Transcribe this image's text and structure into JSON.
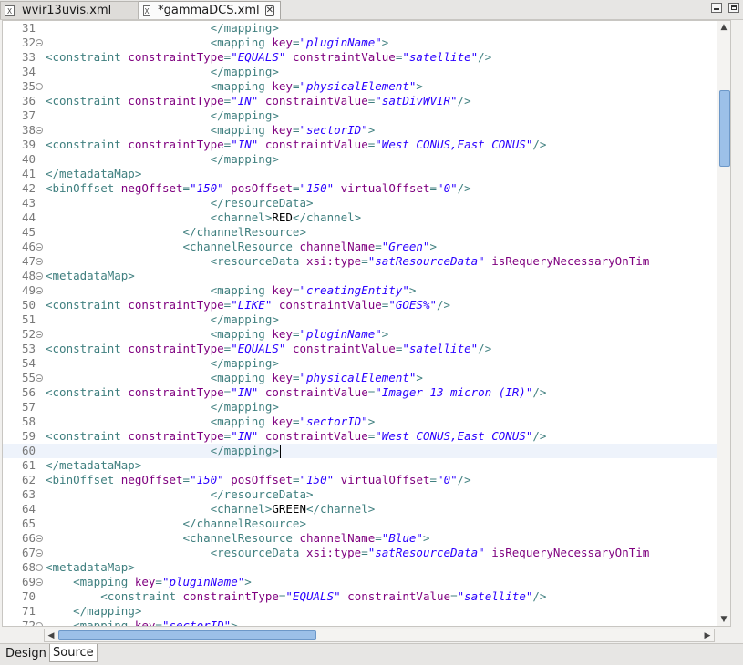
{
  "tabs": [
    {
      "label": "wvir13uvis.xml",
      "icon": "xml-file-icon",
      "active": false
    },
    {
      "label": "*gammaDCS.xml",
      "icon": "xml-file-icon",
      "active": true
    }
  ],
  "bottom_tabs": [
    {
      "label": "Design",
      "active": false
    },
    {
      "label": "Source",
      "active": true
    }
  ],
  "colors": {
    "tag": "#3f7f7f",
    "attr_name": "#7f007f",
    "attr_value": "#2a00ff",
    "text": "#000000",
    "line_number": "#787878"
  },
  "cursor_line": 60,
  "lines": [
    {
      "n": "31",
      "fold": false,
      "tokens": [
        [
          "s",
          "                        "
        ],
        [
          "t",
          "</mapping>"
        ]
      ]
    },
    {
      "n": "32",
      "fold": true,
      "tokens": [
        [
          "s",
          "                        "
        ],
        [
          "t",
          "<mapping "
        ],
        [
          "a",
          "key"
        ],
        [
          "t",
          "="
        ],
        [
          "v",
          "\"pluginName\""
        ],
        [
          "t",
          ">"
        ]
      ]
    },
    {
      "n": "33",
      "fold": false,
      "tokens": [
        [
          "t",
          "<constraint "
        ],
        [
          "a",
          "constraintType"
        ],
        [
          "t",
          "="
        ],
        [
          "v",
          "\"EQUALS\""
        ],
        [
          "s",
          " "
        ],
        [
          "a",
          "constraintValue"
        ],
        [
          "t",
          "="
        ],
        [
          "v",
          "\"satellite\""
        ],
        [
          "t",
          "/>"
        ]
      ]
    },
    {
      "n": "34",
      "fold": false,
      "tokens": [
        [
          "s",
          "                        "
        ],
        [
          "t",
          "</mapping>"
        ]
      ]
    },
    {
      "n": "35",
      "fold": true,
      "tokens": [
        [
          "s",
          "                        "
        ],
        [
          "t",
          "<mapping "
        ],
        [
          "a",
          "key"
        ],
        [
          "t",
          "="
        ],
        [
          "v",
          "\"physicalElement\""
        ],
        [
          "t",
          ">"
        ]
      ]
    },
    {
      "n": "36",
      "fold": false,
      "tokens": [
        [
          "t",
          "<constraint "
        ],
        [
          "a",
          "constraintType"
        ],
        [
          "t",
          "="
        ],
        [
          "v",
          "\"IN\""
        ],
        [
          "s",
          " "
        ],
        [
          "a",
          "constraintValue"
        ],
        [
          "t",
          "="
        ],
        [
          "v",
          "\"satDivWVIR\""
        ],
        [
          "t",
          "/>"
        ]
      ]
    },
    {
      "n": "37",
      "fold": false,
      "tokens": [
        [
          "s",
          "                        "
        ],
        [
          "t",
          "</mapping>"
        ]
      ]
    },
    {
      "n": "38",
      "fold": true,
      "tokens": [
        [
          "s",
          "                        "
        ],
        [
          "t",
          "<mapping "
        ],
        [
          "a",
          "key"
        ],
        [
          "t",
          "="
        ],
        [
          "v",
          "\"sectorID\""
        ],
        [
          "t",
          ">"
        ]
      ]
    },
    {
      "n": "39",
      "fold": false,
      "tokens": [
        [
          "t",
          "<constraint "
        ],
        [
          "a",
          "constraintType"
        ],
        [
          "t",
          "="
        ],
        [
          "v",
          "\"IN\""
        ],
        [
          "s",
          " "
        ],
        [
          "a",
          "constraintValue"
        ],
        [
          "t",
          "="
        ],
        [
          "v",
          "\"West CONUS,East CONUS\""
        ],
        [
          "t",
          "/>"
        ]
      ]
    },
    {
      "n": "40",
      "fold": false,
      "tokens": [
        [
          "s",
          "                        "
        ],
        [
          "t",
          "</mapping>"
        ]
      ]
    },
    {
      "n": "41",
      "fold": false,
      "tokens": [
        [
          "t",
          "</metadataMap>"
        ]
      ]
    },
    {
      "n": "42",
      "fold": false,
      "tokens": [
        [
          "t",
          "<binOffset "
        ],
        [
          "a",
          "negOffset"
        ],
        [
          "t",
          "="
        ],
        [
          "v",
          "\"150\""
        ],
        [
          "s",
          " "
        ],
        [
          "a",
          "posOffset"
        ],
        [
          "t",
          "="
        ],
        [
          "v",
          "\"150\""
        ],
        [
          "s",
          " "
        ],
        [
          "a",
          "virtualOffset"
        ],
        [
          "t",
          "="
        ],
        [
          "v",
          "\"0\""
        ],
        [
          "t",
          "/>"
        ]
      ]
    },
    {
      "n": "43",
      "fold": false,
      "tokens": [
        [
          "s",
          "                        "
        ],
        [
          "t",
          "</resourceData>"
        ]
      ]
    },
    {
      "n": "44",
      "fold": false,
      "tokens": [
        [
          "s",
          "                        "
        ],
        [
          "t",
          "<channel>"
        ],
        [
          "x",
          "RED"
        ],
        [
          "t",
          "</channel>"
        ]
      ]
    },
    {
      "n": "45",
      "fold": false,
      "tokens": [
        [
          "s",
          "                    "
        ],
        [
          "t",
          "</channelResource>"
        ]
      ]
    },
    {
      "n": "46",
      "fold": true,
      "tokens": [
        [
          "s",
          "                    "
        ],
        [
          "t",
          "<channelResource "
        ],
        [
          "a",
          "channelName"
        ],
        [
          "t",
          "="
        ],
        [
          "v",
          "\"Green\""
        ],
        [
          "t",
          ">"
        ]
      ]
    },
    {
      "n": "47",
      "fold": true,
      "tokens": [
        [
          "s",
          "                        "
        ],
        [
          "t",
          "<resourceData "
        ],
        [
          "a",
          "xsi:type"
        ],
        [
          "t",
          "="
        ],
        [
          "v",
          "\"satResourceData\""
        ],
        [
          "s",
          " "
        ],
        [
          "a",
          "isRequeryNecessaryOnTim"
        ]
      ]
    },
    {
      "n": "48",
      "fold": true,
      "tokens": [
        [
          "t",
          "<metadataMap>"
        ]
      ]
    },
    {
      "n": "49",
      "fold": true,
      "tokens": [
        [
          "s",
          "                        "
        ],
        [
          "t",
          "<mapping "
        ],
        [
          "a",
          "key"
        ],
        [
          "t",
          "="
        ],
        [
          "v",
          "\"creatingEntity\""
        ],
        [
          "t",
          ">"
        ]
      ]
    },
    {
      "n": "50",
      "fold": false,
      "tokens": [
        [
          "t",
          "<constraint "
        ],
        [
          "a",
          "constraintType"
        ],
        [
          "t",
          "="
        ],
        [
          "v",
          "\"LIKE\""
        ],
        [
          "s",
          " "
        ],
        [
          "a",
          "constraintValue"
        ],
        [
          "t",
          "="
        ],
        [
          "v",
          "\"GOES%\""
        ],
        [
          "t",
          "/>"
        ]
      ]
    },
    {
      "n": "51",
      "fold": false,
      "tokens": [
        [
          "s",
          "                        "
        ],
        [
          "t",
          "</mapping>"
        ]
      ]
    },
    {
      "n": "52",
      "fold": true,
      "tokens": [
        [
          "s",
          "                        "
        ],
        [
          "t",
          "<mapping "
        ],
        [
          "a",
          "key"
        ],
        [
          "t",
          "="
        ],
        [
          "v",
          "\"pluginName\""
        ],
        [
          "t",
          ">"
        ]
      ]
    },
    {
      "n": "53",
      "fold": false,
      "tokens": [
        [
          "t",
          "<constraint "
        ],
        [
          "a",
          "constraintType"
        ],
        [
          "t",
          "="
        ],
        [
          "v",
          "\"EQUALS\""
        ],
        [
          "s",
          " "
        ],
        [
          "a",
          "constraintValue"
        ],
        [
          "t",
          "="
        ],
        [
          "v",
          "\"satellite\""
        ],
        [
          "t",
          "/>"
        ]
      ]
    },
    {
      "n": "54",
      "fold": false,
      "tokens": [
        [
          "s",
          "                        "
        ],
        [
          "t",
          "</mapping>"
        ]
      ]
    },
    {
      "n": "55",
      "fold": true,
      "tokens": [
        [
          "s",
          "                        "
        ],
        [
          "t",
          "<mapping "
        ],
        [
          "a",
          "key"
        ],
        [
          "t",
          "="
        ],
        [
          "v",
          "\"physicalElement\""
        ],
        [
          "t",
          ">"
        ]
      ]
    },
    {
      "n": "56",
      "fold": false,
      "tokens": [
        [
          "t",
          "<constraint "
        ],
        [
          "a",
          "constraintType"
        ],
        [
          "t",
          "="
        ],
        [
          "v",
          "\"IN\""
        ],
        [
          "s",
          " "
        ],
        [
          "a",
          "constraintValue"
        ],
        [
          "t",
          "="
        ],
        [
          "v",
          "\"Imager 13 micron (IR)\""
        ],
        [
          "t",
          "/>"
        ]
      ]
    },
    {
      "n": "57",
      "fold": false,
      "tokens": [
        [
          "s",
          "                        "
        ],
        [
          "t",
          "</mapping>"
        ]
      ]
    },
    {
      "n": "58",
      "fold": false,
      "tokens": [
        [
          "s",
          "                        "
        ],
        [
          "t",
          "<mapping "
        ],
        [
          "a",
          "key"
        ],
        [
          "t",
          "="
        ],
        [
          "v",
          "\"sectorID\""
        ],
        [
          "t",
          ">"
        ]
      ]
    },
    {
      "n": "59",
      "fold": false,
      "tokens": [
        [
          "t",
          "<constraint "
        ],
        [
          "a",
          "constraintType"
        ],
        [
          "t",
          "="
        ],
        [
          "v",
          "\"IN\""
        ],
        [
          "s",
          " "
        ],
        [
          "a",
          "constraintValue"
        ],
        [
          "t",
          "="
        ],
        [
          "v",
          "\"West CONUS,East CONUS\""
        ],
        [
          "t",
          "/>"
        ]
      ]
    },
    {
      "n": "60",
      "fold": false,
      "tokens": [
        [
          "s",
          "                        "
        ],
        [
          "t",
          "</mapping>"
        ]
      ]
    },
    {
      "n": "61",
      "fold": false,
      "tokens": [
        [
          "t",
          "</metadataMap>"
        ]
      ]
    },
    {
      "n": "62",
      "fold": false,
      "tokens": [
        [
          "t",
          "<binOffset "
        ],
        [
          "a",
          "negOffset"
        ],
        [
          "t",
          "="
        ],
        [
          "v",
          "\"150\""
        ],
        [
          "s",
          " "
        ],
        [
          "a",
          "posOffset"
        ],
        [
          "t",
          "="
        ],
        [
          "v",
          "\"150\""
        ],
        [
          "s",
          " "
        ],
        [
          "a",
          "virtualOffset"
        ],
        [
          "t",
          "="
        ],
        [
          "v",
          "\"0\""
        ],
        [
          "t",
          "/>"
        ]
      ]
    },
    {
      "n": "63",
      "fold": false,
      "tokens": [
        [
          "s",
          "                        "
        ],
        [
          "t",
          "</resourceData>"
        ]
      ]
    },
    {
      "n": "64",
      "fold": false,
      "tokens": [
        [
          "s",
          "                        "
        ],
        [
          "t",
          "<channel>"
        ],
        [
          "x",
          "GREEN"
        ],
        [
          "t",
          "</channel>"
        ]
      ]
    },
    {
      "n": "65",
      "fold": false,
      "tokens": [
        [
          "s",
          "                    "
        ],
        [
          "t",
          "</channelResource>"
        ]
      ]
    },
    {
      "n": "66",
      "fold": true,
      "tokens": [
        [
          "s",
          "                    "
        ],
        [
          "t",
          "<channelResource "
        ],
        [
          "a",
          "channelName"
        ],
        [
          "t",
          "="
        ],
        [
          "v",
          "\"Blue\""
        ],
        [
          "t",
          ">"
        ]
      ]
    },
    {
      "n": "67",
      "fold": true,
      "tokens": [
        [
          "s",
          "                        "
        ],
        [
          "t",
          "<resourceData "
        ],
        [
          "a",
          "xsi:type"
        ],
        [
          "t",
          "="
        ],
        [
          "v",
          "\"satResourceData\""
        ],
        [
          "s",
          " "
        ],
        [
          "a",
          "isRequeryNecessaryOnTim"
        ]
      ]
    },
    {
      "n": "68",
      "fold": true,
      "tokens": [
        [
          "t",
          "<metadataMap>"
        ]
      ]
    },
    {
      "n": "69",
      "fold": true,
      "tokens": [
        [
          "s",
          "    "
        ],
        [
          "t",
          "<mapping "
        ],
        [
          "a",
          "key"
        ],
        [
          "t",
          "="
        ],
        [
          "v",
          "\"pluginName\""
        ],
        [
          "t",
          ">"
        ]
      ]
    },
    {
      "n": "70",
      "fold": false,
      "tokens": [
        [
          "s",
          "        "
        ],
        [
          "t",
          "<constraint "
        ],
        [
          "a",
          "constraintType"
        ],
        [
          "t",
          "="
        ],
        [
          "v",
          "\"EQUALS\""
        ],
        [
          "s",
          " "
        ],
        [
          "a",
          "constraintValue"
        ],
        [
          "t",
          "="
        ],
        [
          "v",
          "\"satellite\""
        ],
        [
          "t",
          "/>"
        ]
      ]
    },
    {
      "n": "71",
      "fold": false,
      "tokens": [
        [
          "s",
          "    "
        ],
        [
          "t",
          "</mapping>"
        ]
      ]
    },
    {
      "n": "72",
      "fold": true,
      "tokens": [
        [
          "s",
          "    "
        ],
        [
          "t",
          "<mapping "
        ],
        [
          "a",
          "key"
        ],
        [
          "t",
          "="
        ],
        [
          "v",
          "\"sectorID\""
        ],
        [
          "t",
          ">"
        ]
      ]
    }
  ]
}
